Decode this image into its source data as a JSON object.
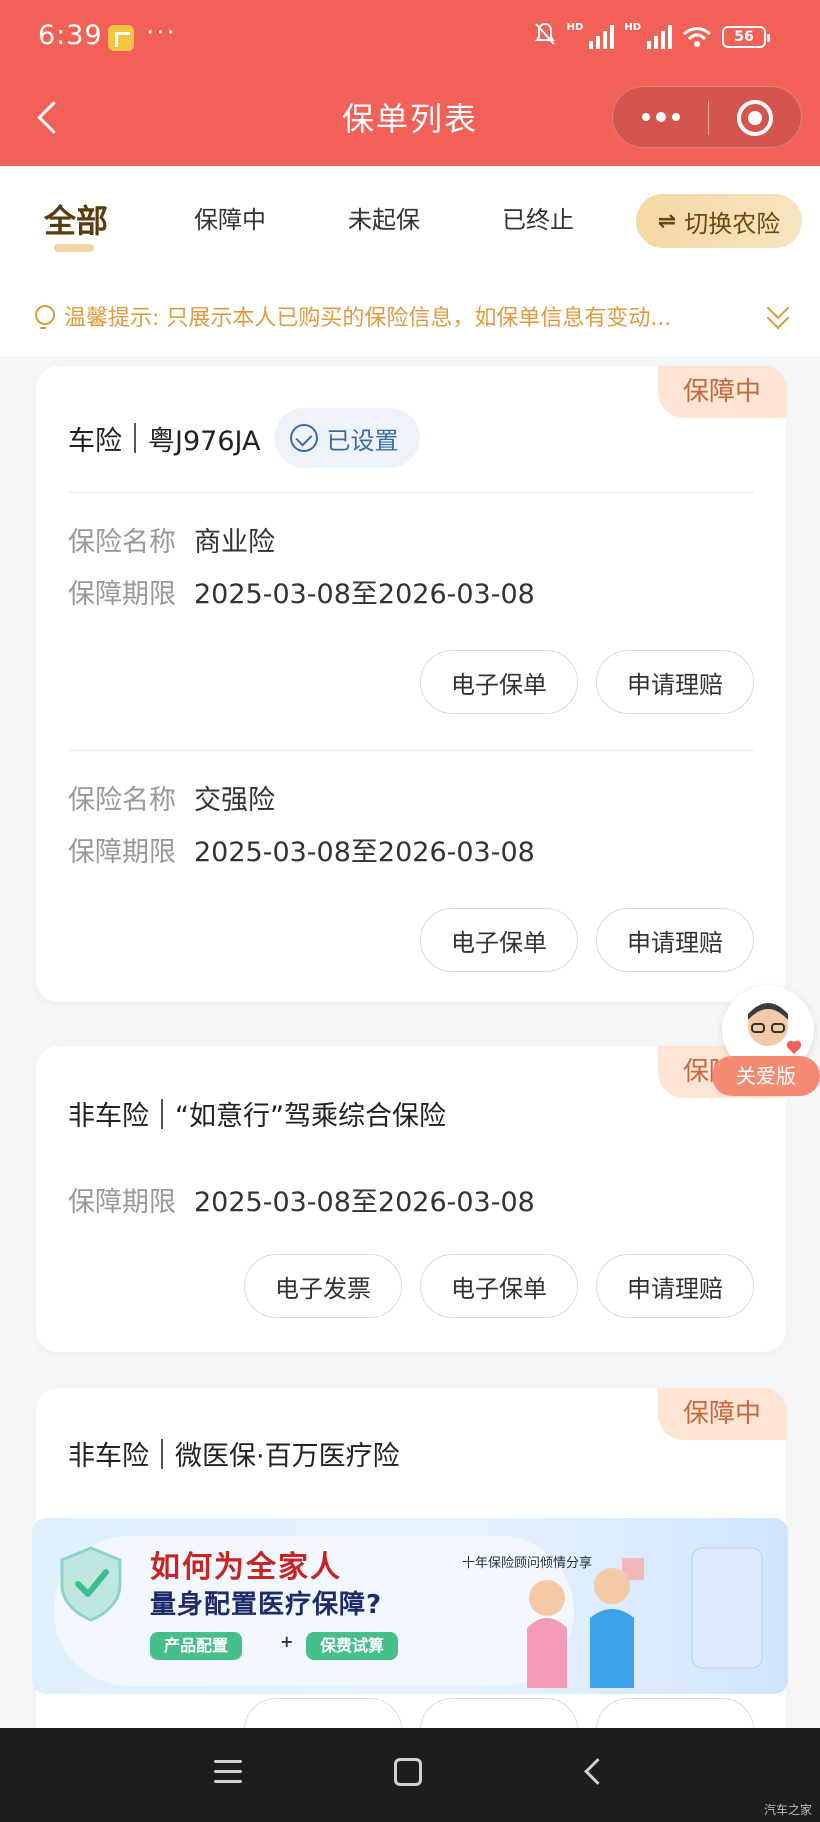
{
  "status_bar": {
    "time": "6:39",
    "more": "···",
    "signal_label": "HD",
    "battery": "56"
  },
  "header": {
    "title": "保单列表"
  },
  "tabs": {
    "items": [
      "全部",
      "保障中",
      "未起保",
      "已终止"
    ],
    "active": "全部",
    "switch_label": "切换农险",
    "switch_icon": "⇌"
  },
  "tip": {
    "text": "温馨提示: 只展示本人已购买的保险信息，如保单信息有变动..."
  },
  "cards": [
    {
      "badge": "保障中",
      "type": "车险",
      "name": "粤J976JA",
      "setting": "已设置",
      "sections": [
        {
          "name_key": "保险名称",
          "name_value": "商业险",
          "period_key": "保障期限",
          "period_value": "2025-03-08至2026-03-08",
          "actions": [
            "电子保单",
            "申请理赔"
          ]
        },
        {
          "name_key": "保险名称",
          "name_value": "交强险",
          "period_key": "保障期限",
          "period_value": "2025-03-08至2026-03-08",
          "actions": [
            "电子保单",
            "申请理赔"
          ]
        }
      ]
    },
    {
      "badge": "保障中",
      "type": "非车险",
      "name": "“如意行”驾乘综合保险",
      "period_key": "保障期限",
      "period_value": "2025-03-08至2026-03-08",
      "actions": [
        "电子发票",
        "电子保单",
        "申请理赔"
      ]
    },
    {
      "badge": "保障中",
      "type": "非车险",
      "name": "微医保·百万医疗险"
    }
  ],
  "care_float": {
    "label": "关爱版"
  },
  "ad": {
    "title1": "如何为全家人",
    "title2": "量身配置医疗保障?",
    "tag1": "产品配置",
    "plus": "+",
    "tag2": "保费试算",
    "sub": "十年保险顾问倾情分享"
  },
  "watermark": "汽车之家",
  "colors": {
    "header_bg": "#f26158",
    "badge_bg": "#fde4d4",
    "badge_text": "#c8693d",
    "tip_text": "#e29a3f",
    "setting_text": "#3f6aa5"
  }
}
